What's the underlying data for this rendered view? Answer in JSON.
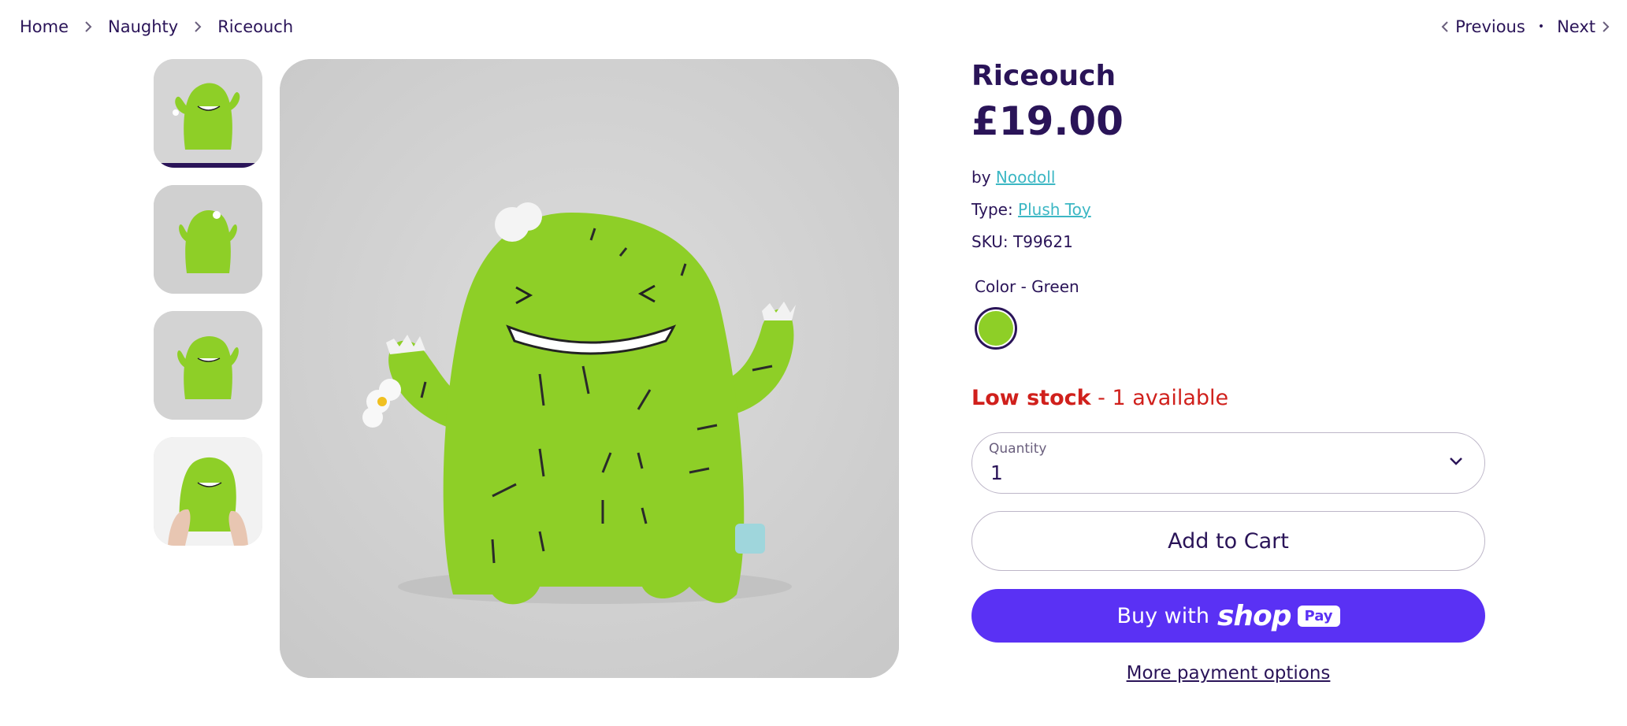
{
  "breadcrumb": {
    "home": "Home",
    "collection": "Naughty",
    "current": "Riceouch"
  },
  "pager": {
    "previous": "Previous",
    "next": "Next"
  },
  "product": {
    "title": "Riceouch",
    "price": "£19.00",
    "vendor_prefix": "by",
    "vendor": "Noodoll",
    "type_prefix": "Type:",
    "type": "Plush Toy",
    "sku_prefix": "SKU:",
    "sku": "T99621",
    "color_label": "Color - Green",
    "color_hex": "#8ecf27",
    "stock_status": "Low stock",
    "stock_detail": " - 1 available",
    "quantity_label": "Quantity",
    "quantity_value": "1",
    "add_to_cart": "Add to Cart",
    "buy_with": "Buy with",
    "shop_brand": "shop",
    "shop_pay_badge": "Pay",
    "more_payment": "More payment options"
  },
  "colors": {
    "text": "#2a1458",
    "link": "#3cb7c4",
    "low_stock": "#d0201c",
    "shop_pay": "#5a31f4",
    "plush_green": "#8ecf27"
  }
}
